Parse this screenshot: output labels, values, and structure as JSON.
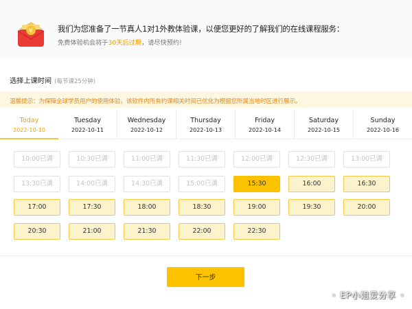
{
  "banner": {
    "title": "我们为您准备了一节真人1对1外教体验课，以便您更好的了解我们的在线课程服务：",
    "sub_prefix": "免费体验机会将于",
    "sub_highlight": "30天后过期",
    "sub_suffix": "，请尽快预约!",
    "icon_glyph": "¥"
  },
  "section": {
    "title": "选择上课时间",
    "note": "(每节课25分钟)"
  },
  "notice": "温馨提示：为保障全球学员用户的使用体验，该软件内所有约课相关时间已优化为根据您所属当地时区进行展示。",
  "tabs": [
    {
      "day": "Today",
      "date": "2022-10-10"
    },
    {
      "day": "Tuesday",
      "date": "2022-10-11"
    },
    {
      "day": "Wednesday",
      "date": "2022-10-12"
    },
    {
      "day": "Thursday",
      "date": "2022-10-13"
    },
    {
      "day": "Friday",
      "date": "2022-10-14"
    },
    {
      "day": "Saturday",
      "date": "2022-10-15"
    },
    {
      "day": "Sunday",
      "date": "2022-10-16"
    }
  ],
  "slots": [
    {
      "label": "10:00已满",
      "state": "full"
    },
    {
      "label": "10:30已满",
      "state": "full"
    },
    {
      "label": "11:00已满",
      "state": "full"
    },
    {
      "label": "11:30已满",
      "state": "full"
    },
    {
      "label": "12:00已满",
      "state": "full"
    },
    {
      "label": "12:30已满",
      "state": "full"
    },
    {
      "label": "13:00已满",
      "state": "full"
    },
    {
      "label": "13:30已满",
      "state": "full"
    },
    {
      "label": "14:00已满",
      "state": "full"
    },
    {
      "label": "14:30已满",
      "state": "full"
    },
    {
      "label": "15:00已满",
      "state": "full"
    },
    {
      "label": "15:30",
      "state": "selected"
    },
    {
      "label": "16:00",
      "state": "open"
    },
    {
      "label": "16:30",
      "state": "open"
    },
    {
      "label": "17:00",
      "state": "open"
    },
    {
      "label": "17:30",
      "state": "open"
    },
    {
      "label": "18:00",
      "state": "open"
    },
    {
      "label": "18:30",
      "state": "open"
    },
    {
      "label": "19:00",
      "state": "open"
    },
    {
      "label": "19:30",
      "state": "open"
    },
    {
      "label": "20:00",
      "state": "open"
    },
    {
      "label": "20:30",
      "state": "open"
    },
    {
      "label": "21:00",
      "state": "open"
    },
    {
      "label": "21:30",
      "state": "open"
    },
    {
      "label": "22:00",
      "state": "open"
    },
    {
      "label": "22:30",
      "state": "open"
    }
  ],
  "next_button": "下一步",
  "watermark": "◦ EP小姐爱分享 ◦",
  "colors": {
    "accent": "#fbc200",
    "slot_open_bg": "#fcf3cc",
    "notice_text": "#e08a1e",
    "notice_bg": "#fdf6e1"
  }
}
